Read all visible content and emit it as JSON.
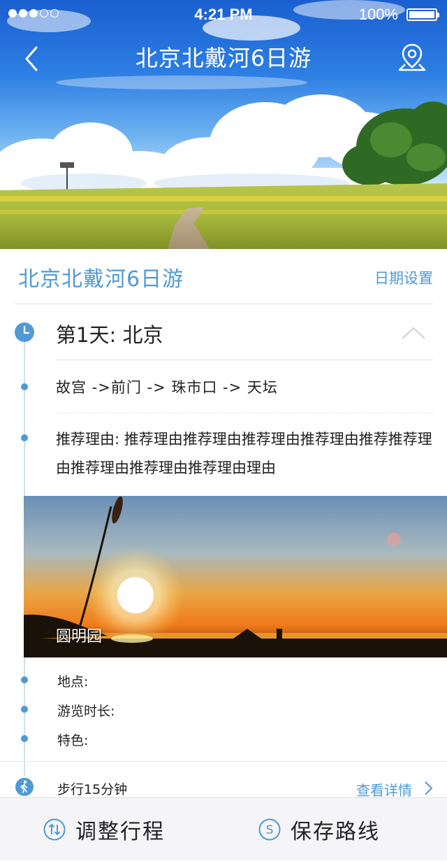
{
  "status_bar": {
    "time": "4:21 PM",
    "battery": "100%",
    "signal_bars_filled": 3,
    "signal_bars_total": 5
  },
  "nav": {
    "title": "北京北戴河6日游",
    "back_icon": "chevron-left-icon",
    "map_icon": "map-pin-icon"
  },
  "trip": {
    "title": "北京北戴河6日游",
    "date_setting_label": "日期设置"
  },
  "day": {
    "title": "第1天: 北京",
    "route": "故宫 ->前门 -> 珠市口 -> 天坛",
    "reason": "推荐理由: 推荐理由推荐理由推荐理由推荐理由推荐推荐理由推荐理由推荐理由推荐理由理由",
    "photo_caption": "圆明园",
    "location_label": "地点:",
    "duration_label": "游览时长:",
    "feature_label": "特色:"
  },
  "transit": {
    "text": "步行15分钟",
    "detail_label": "查看详情"
  },
  "bottom_bar": {
    "adjust_label": "调整行程",
    "save_label": "保存路线"
  },
  "colors": {
    "accent": "#4f9ad6",
    "text": "#222222",
    "divider": "#e2e2e2",
    "bottom_bar_bg": "#f5f5f7"
  }
}
